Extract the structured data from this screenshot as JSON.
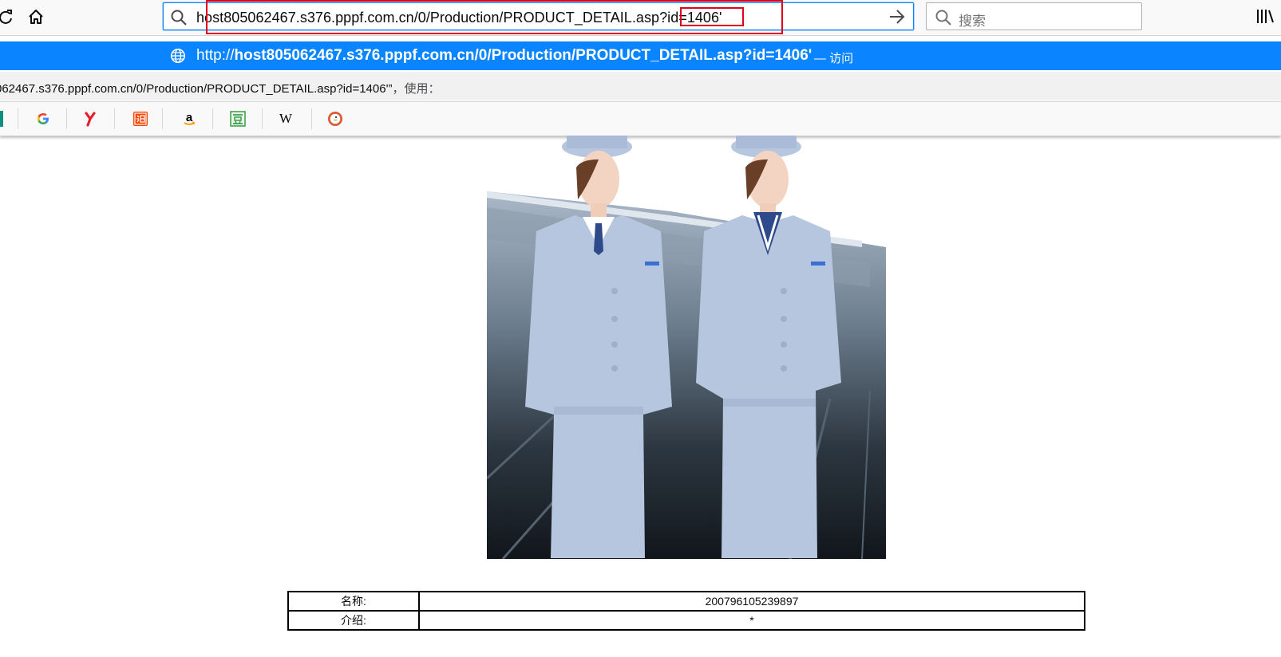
{
  "toolbar": {
    "url_value": "host805062467.s376.pppf.com.cn/0/Production/PRODUCT_DETAIL.asp?id=1406'",
    "search_placeholder": "搜索",
    "icons": [
      "reload-icon",
      "home-icon",
      "search-icon",
      "go-arrow-icon",
      "library-icon"
    ]
  },
  "popup": {
    "url_prefix": "http://",
    "url_bold": "host805062467.s376.pppf.com.cn/0/Production/PRODUCT_DETAIL.asp?id=1406'",
    "action_separator": "—",
    "action": "访问",
    "search_hint": "062467.s376.pppf.com.cn/0/Production/PRODUCT_DETAIL.asp?id=1406'”",
    "search_hint_suffix": "，使用："
  },
  "bookmarks": [
    {
      "icon": "google-icon",
      "glyph": "G",
      "color": "#4285f4"
    },
    {
      "icon": "youku-icon",
      "glyph": "y",
      "color": "#e5202e"
    },
    {
      "icon": "taobao-icon",
      "glyph": "淘",
      "color": "#ff4400"
    },
    {
      "icon": "amazon-icon",
      "glyph": "a",
      "color": "#000000"
    },
    {
      "icon": "douban-icon",
      "glyph": "豆",
      "color": "#2e963d"
    },
    {
      "icon": "wikipedia-icon",
      "glyph": "W",
      "color": "#000000"
    },
    {
      "icon": "duckduckgo-icon",
      "glyph": "D",
      "color": "#de5833"
    }
  ],
  "content": {
    "table": [
      {
        "label": "名称:",
        "value": "200796105239897"
      },
      {
        "label": "介绍:",
        "value": "*"
      }
    ]
  },
  "colors": {
    "accent": "#0a84ff",
    "highlight_box": "#e0001b",
    "uniform": "#b7c6df"
  }
}
